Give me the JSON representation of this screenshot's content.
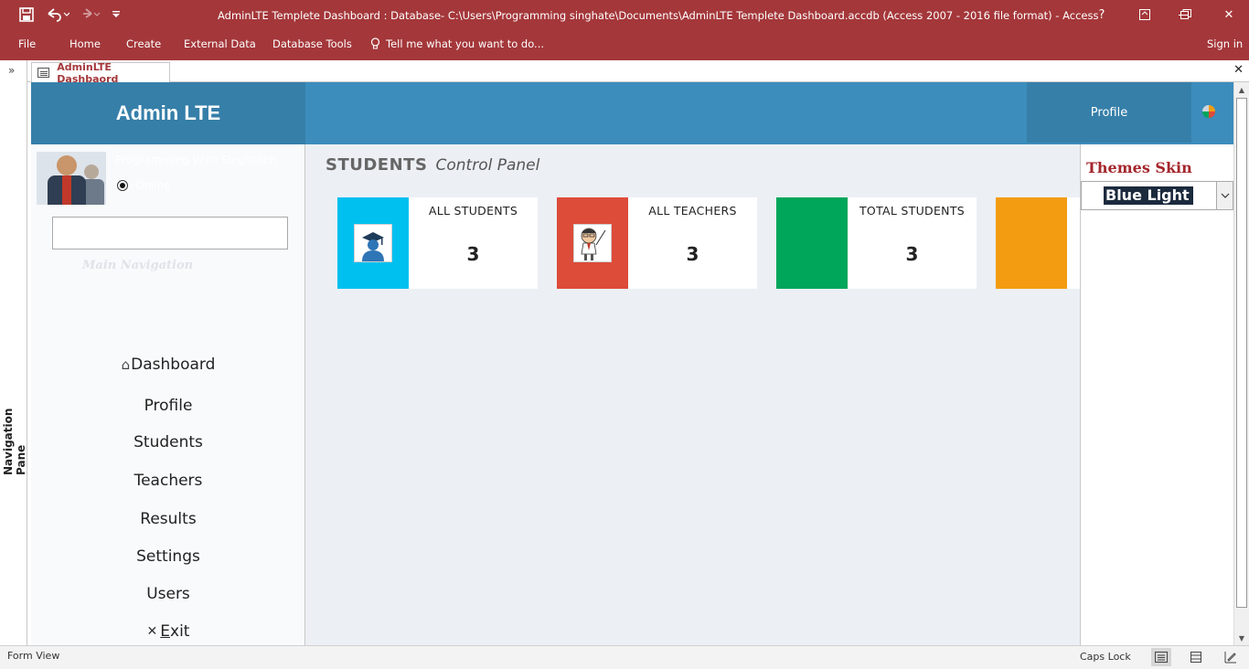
{
  "window": {
    "title": "AdminLTE Templete Dashboard : Database- C:\\Users\\Programming singhate\\Documents\\AdminLTE Templete Dashboard.accdb (Access 2007 - 2016 file format) - Access",
    "help": "?",
    "minimize": "—",
    "restore": "❐",
    "close": "✕"
  },
  "ribbon": {
    "tabs": [
      "File",
      "Home",
      "Create",
      "External Data",
      "Database Tools"
    ],
    "tell_me": "Tell me what you want to do...",
    "sign_in": "Sign in"
  },
  "nav_pane": {
    "label": "Navigation Pane",
    "toggle": "»"
  },
  "document_tab": {
    "label": "AdminLTE Dashbaord",
    "close": "✕"
  },
  "header": {
    "brand": "Admin LTE",
    "profile": "Profile"
  },
  "sidebar": {
    "user_name": "Programming With Singhateh",
    "status": "Online",
    "search_value": "",
    "nav_header": "Main Navigation",
    "items": [
      {
        "label": "Dashboard",
        "icon": "home-icon"
      },
      {
        "label": "Profile"
      },
      {
        "label": "Students"
      },
      {
        "label": "Teachers"
      },
      {
        "label": "Results"
      },
      {
        "label": "Settings"
      },
      {
        "label": "Users"
      },
      {
        "label_pre": "",
        "label_ul": "E",
        "label_post": "xit",
        "icon": "close-icon"
      }
    ]
  },
  "content": {
    "title": "STUDENTS",
    "subtitle": "Control Panel",
    "boxes": [
      {
        "label": "ALL STUDENTS",
        "value": "3",
        "color": "#00c0ef",
        "icon": "graduate-icon"
      },
      {
        "label": "ALL TEACHERS",
        "value": "3",
        "color": "#dd4b39",
        "icon": "teacher-icon"
      },
      {
        "label": "TOTAL STUDENTS",
        "value": "3",
        "color": "#00a65a",
        "icon": ""
      },
      {
        "label": "",
        "value": "",
        "color": "#f39c12",
        "icon": ""
      }
    ]
  },
  "themes": {
    "title": "Themes Skin",
    "selected": "Blue Light"
  },
  "statusbar": {
    "left": "Form View",
    "caps": "Caps Lock"
  },
  "colors": {
    "titlebar": "#a4373a",
    "brand": "#367fa9",
    "topnav": "#3c8dbc",
    "content_bg": "#ecf0f5"
  }
}
